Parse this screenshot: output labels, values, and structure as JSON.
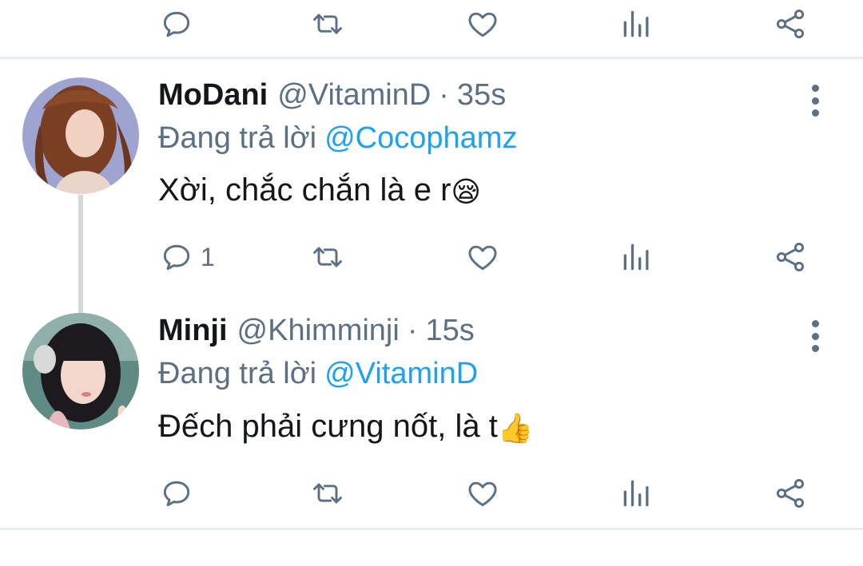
{
  "tweets": [
    {
      "name": "MoDani",
      "handle": "@VitaminD",
      "dot": "·",
      "time": "35s",
      "reply_prefix": "Đang trả lời",
      "reply_to": "@Cocophamz",
      "text": "Xời, chắc chắn là e r",
      "emoji": "😪",
      "reply_count": "1",
      "retweet_count": "",
      "like_count": ""
    },
    {
      "name": "Minji",
      "handle": "@Khimminji",
      "dot": "·",
      "time": "15s",
      "reply_prefix": "Đang trả lời",
      "reply_to": "@VitaminD",
      "text": "Đếch phải cưng nốt, là t",
      "emoji": "👍",
      "reply_count": "",
      "retweet_count": "",
      "like_count": ""
    }
  ],
  "icons": [
    "reply-icon",
    "retweet-icon",
    "like-icon",
    "analytics-icon",
    "share-icon",
    "more-icon"
  ],
  "colors": {
    "icon_gray": "#5b7083",
    "mention_blue": "#1da1f2",
    "divider": "#e6ecf0",
    "thread_line": "#cfd9de"
  }
}
